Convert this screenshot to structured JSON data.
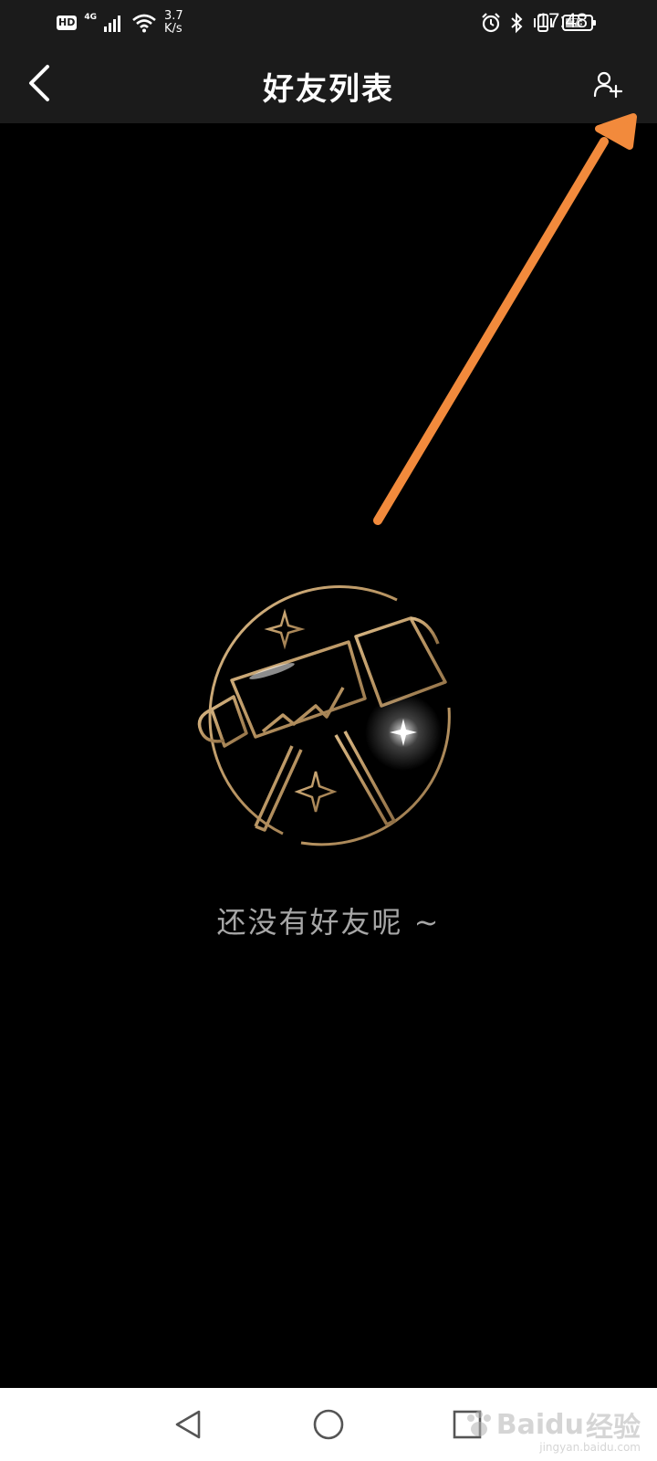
{
  "status_bar": {
    "hd_label": "HD",
    "network_type": "4G",
    "speed_value": "3.7",
    "speed_unit": "K/s",
    "battery_level": "78",
    "time": "17:48"
  },
  "header": {
    "title": "好友列表"
  },
  "empty_state": {
    "message": "还没有好友呢 ~"
  },
  "watermark": {
    "brand": "Baidu",
    "brand_cn": "经验",
    "url": "jingyan.baidu.com"
  },
  "colors": {
    "background": "#000000",
    "bar_background": "#1b1b1b",
    "illustration_gold": "#b89462",
    "message_gray": "#a7a7a7",
    "annotation_arrow": "#f28a3c",
    "nav_background": "#ffffff"
  },
  "icons": {
    "back": "chevron-left-icon",
    "add_friend": "add-user-icon",
    "empty_illustration": "telescope-icon",
    "nav_back": "triangle-back-icon",
    "nav_home": "circle-home-icon",
    "nav_recent": "square-recent-icon"
  }
}
